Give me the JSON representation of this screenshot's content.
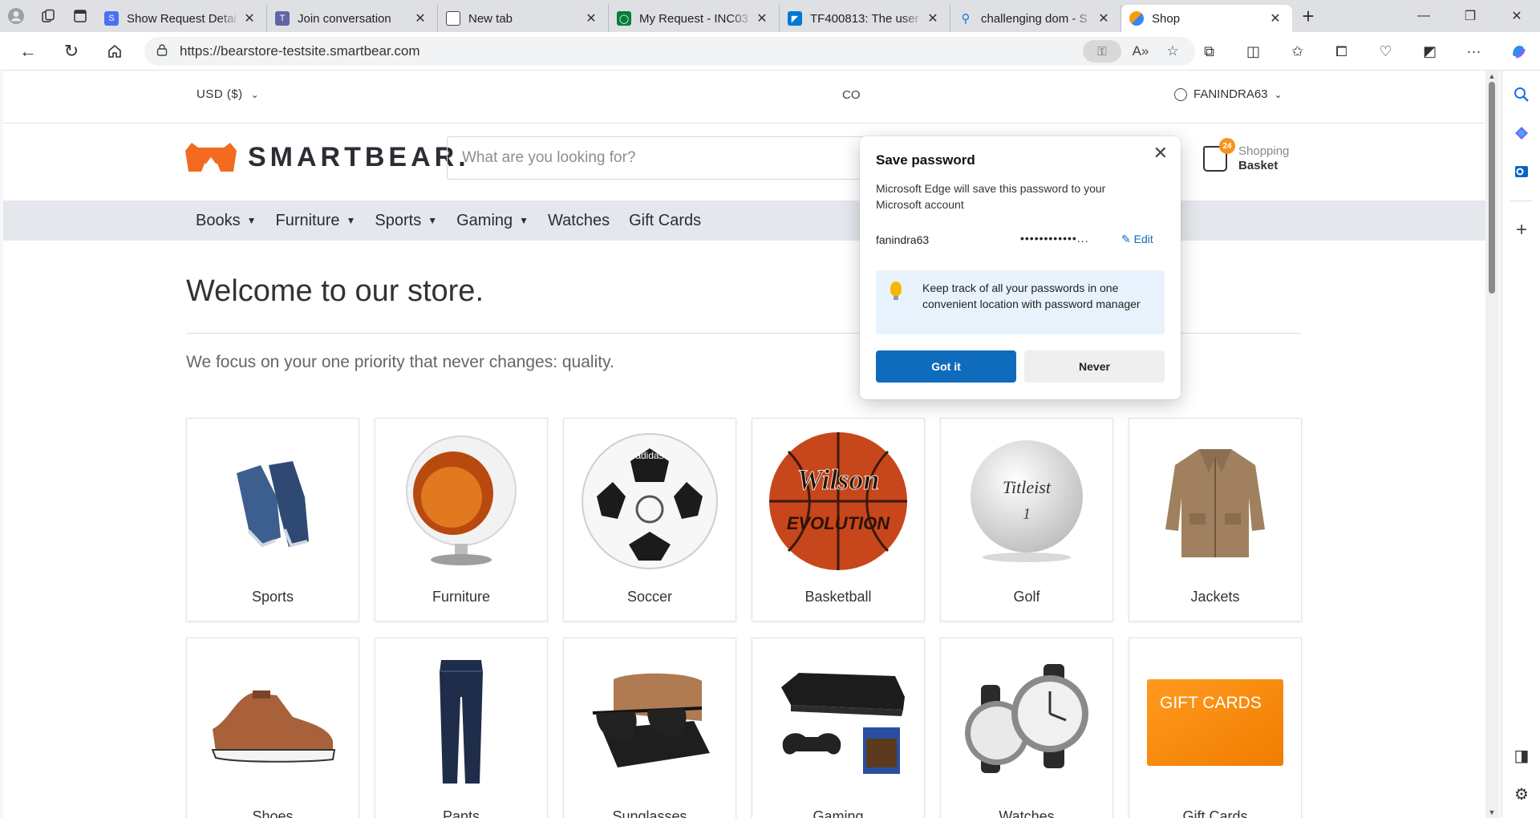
{
  "browser": {
    "tabs": [
      {
        "label": "Show Request Detai",
        "favicon_color": "#4c6ef5"
      },
      {
        "label": "Join conversation",
        "favicon_color": "#6264a7"
      },
      {
        "label": "New tab",
        "favicon_color": "#555555"
      },
      {
        "label": "My Request - INC03",
        "favicon_color": "#0a7d3a"
      },
      {
        "label": "TF400813: The user",
        "favicon_color": "#0078d4"
      },
      {
        "label": "challenging dom - S",
        "favicon_color": "#1a73e8"
      },
      {
        "label": "Shop",
        "favicon_color": "#f59e0b"
      }
    ],
    "url": "https://bearstore-testsite.smartbear.com"
  },
  "store": {
    "currency": "USD ($)",
    "contact": "CO",
    "account": "FANINDRA63",
    "logo_text": "SMARTBEAR.",
    "search_placeholder": "What are you looking for?",
    "basket": {
      "count": "24",
      "line1": "Shopping",
      "line2": "Basket"
    },
    "nav": [
      {
        "label": "Books",
        "dropdown": true
      },
      {
        "label": "Furniture",
        "dropdown": true
      },
      {
        "label": "Sports",
        "dropdown": true
      },
      {
        "label": "Gaming",
        "dropdown": true
      },
      {
        "label": "Watches",
        "dropdown": false
      },
      {
        "label": "Gift Cards",
        "dropdown": false
      }
    ],
    "welcome": "Welcome to our store.",
    "tagline": "We focus on your one priority that never changes: quality.",
    "categories": [
      {
        "name": "Sports",
        "icon": "shoes-icon"
      },
      {
        "name": "Furniture",
        "icon": "ball-chair-icon"
      },
      {
        "name": "Soccer",
        "icon": "soccer-ball-icon"
      },
      {
        "name": "Basketball",
        "icon": "basketball-icon"
      },
      {
        "name": "Golf",
        "icon": "golf-ball-icon"
      },
      {
        "name": "Jackets",
        "icon": "jacket-icon"
      },
      {
        "name": "Shoes",
        "icon": "sneaker-icon"
      },
      {
        "name": "Pants",
        "icon": "jeans-icon"
      },
      {
        "name": "Sunglasses",
        "icon": "sunglasses-icon"
      },
      {
        "name": "Gaming",
        "icon": "console-icon"
      },
      {
        "name": "Watches",
        "icon": "watch-icon"
      },
      {
        "name": "Gift Cards",
        "icon": "gift-card-icon"
      }
    ],
    "product_labels": {
      "wilson": "Wilson",
      "evolution": "EVOLUTION",
      "titleist": "Titleist",
      "adidas": "adidas",
      "giftcard": "GIFT CARDS"
    }
  },
  "popup": {
    "title": "Save password",
    "description": "Microsoft Edge will save this password to your Microsoft account",
    "username": "fanindra63",
    "password_mask": "••••••••••••...",
    "edit_label": "Edit",
    "hint": "Keep track of all your passwords in one convenient location with password manager",
    "primary_button": "Got it",
    "secondary_button": "Never"
  },
  "colors": {
    "accent": "#0f6cbd",
    "brand_orange": "#f26b21",
    "nav_bg": "#e4e7ec"
  }
}
